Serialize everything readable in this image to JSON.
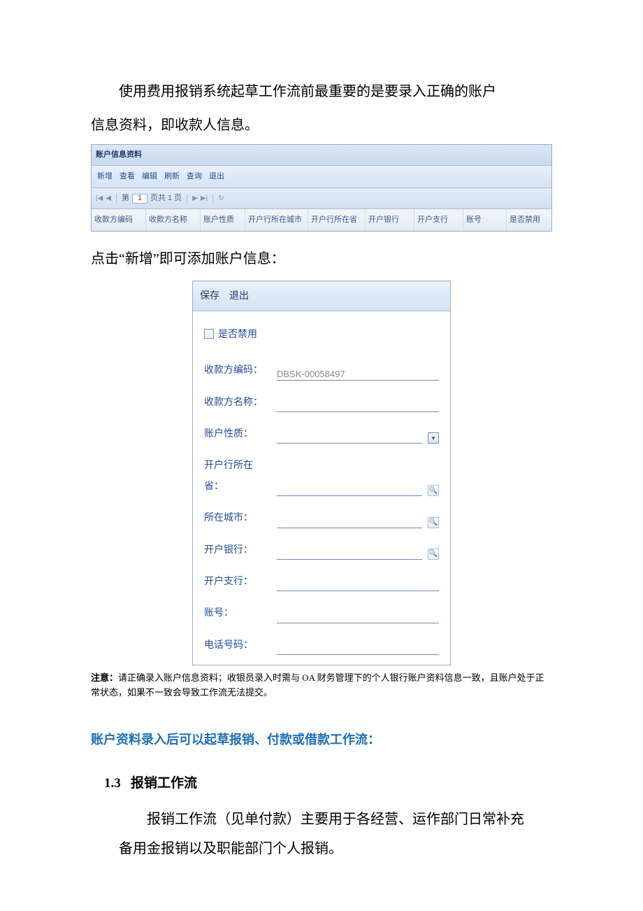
{
  "intro": {
    "p1": "使用费用报销系统起草工作流前最重要的是要录入正确的账户",
    "p2": "信息资料，即收款人信息。"
  },
  "grid": {
    "title": "账户信息资料",
    "toolbar": [
      "新增",
      "查看",
      "编辑",
      "刷新",
      "查询",
      "退出"
    ],
    "pager": {
      "label_prefix": "第",
      "page": "1",
      "label_suffix": "页共 1 页"
    },
    "columns": [
      "收款方编码",
      "收款方名称",
      "账户性质",
      "开户行所在城市",
      "开户行所在省",
      "开户银行",
      "开户支行",
      "账号",
      "是否禁用"
    ]
  },
  "caption": "点击“新增”即可添加账户信息：",
  "form": {
    "toolbar": [
      "保存",
      "退出"
    ],
    "disable_label": "是否禁用",
    "fields": {
      "code": {
        "label": "收款方编码：",
        "value": "DBSK-00058497"
      },
      "name": {
        "label": "收款方名称：",
        "value": ""
      },
      "nature": {
        "label": "账户性质：",
        "value": ""
      },
      "province": {
        "label": "开户行所在省：",
        "value": ""
      },
      "city": {
        "label": "所在城市：",
        "value": ""
      },
      "bank": {
        "label": "开户银行：",
        "value": ""
      },
      "branch": {
        "label": "开户支行：",
        "value": ""
      },
      "account": {
        "label": "账号：",
        "value": ""
      },
      "phone": {
        "label": "电话号码：",
        "value": ""
      }
    }
  },
  "note_label": "注意：",
  "note_text": "请正确录入账户信息资料；收银员录入时需与 OA 财务管理下的个人银行账户资料信息一致，且账户处于正常状态，如果不一致会导致工作流无法提交。",
  "section_blue": "账户资料录入后可以起草报销、付款或借款工作流：",
  "h13_num": "1.3",
  "h13_title": "报销工作流",
  "body13a": "报销工作流（见单付款）主要用于各经营、运作部门日常补充",
  "body13b": "备用金报销以及职能部门个人报销。"
}
